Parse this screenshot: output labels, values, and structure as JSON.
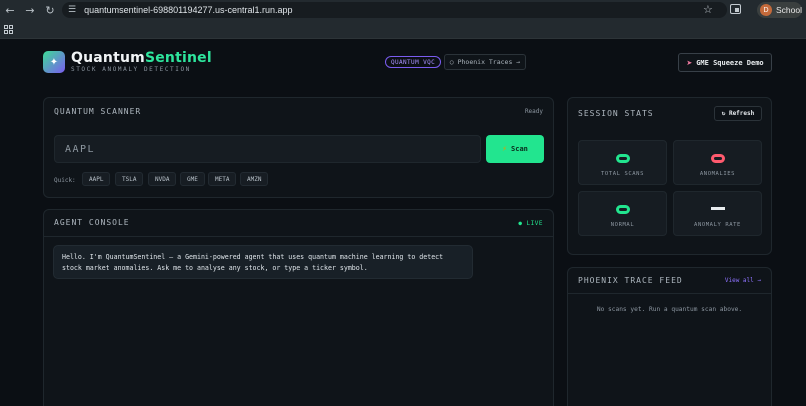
{
  "browser": {
    "url": "quantumsentinel-698801194277.us-central1.run.app",
    "profile_initial": "D",
    "profile_name": "School"
  },
  "header": {
    "brand_quantum": "Quantum",
    "brand_sentinel": "Sentinel",
    "subtitle": "STOCK ANOMALY DETECTION",
    "vqc_badge": "QUANTUM VQC",
    "traces_button": "○ Phoenix Traces →",
    "gme_button": "GME Squeeze Demo"
  },
  "scanner": {
    "title": "QUANTUM SCANNER",
    "status": "Ready",
    "input_placeholder": "AAPL",
    "scan_label": "Scan",
    "quick_label": "Quick:",
    "quick_tickers": [
      "AAPL",
      "TSLA",
      "NVDA",
      "GME",
      "META",
      "AMZN"
    ]
  },
  "console": {
    "title": "AGENT CONSOLE",
    "live_label": "● LIVE",
    "message": "Hello. I'm QuantumSentinel — a Gemini-powered agent that uses quantum machine learning to detect stock market anomalies. Ask me to analyse any stock, or type a ticker symbol."
  },
  "stats": {
    "title": "SESSION STATS",
    "refresh_label": "↻ Refresh",
    "items": [
      {
        "label": "TOTAL SCANS",
        "color": "#22e58f"
      },
      {
        "label": "ANOMALIES",
        "color": "#ff5a6e"
      },
      {
        "label": "NORMAL",
        "color": "#22e58f"
      },
      {
        "label": "ANOMALY RATE",
        "color": "#e8ecef"
      }
    ]
  },
  "feed": {
    "title": "PHOENIX TRACE FEED",
    "view_all": "View all →",
    "empty_text": "No scans yet. Run a quantum scan above."
  }
}
